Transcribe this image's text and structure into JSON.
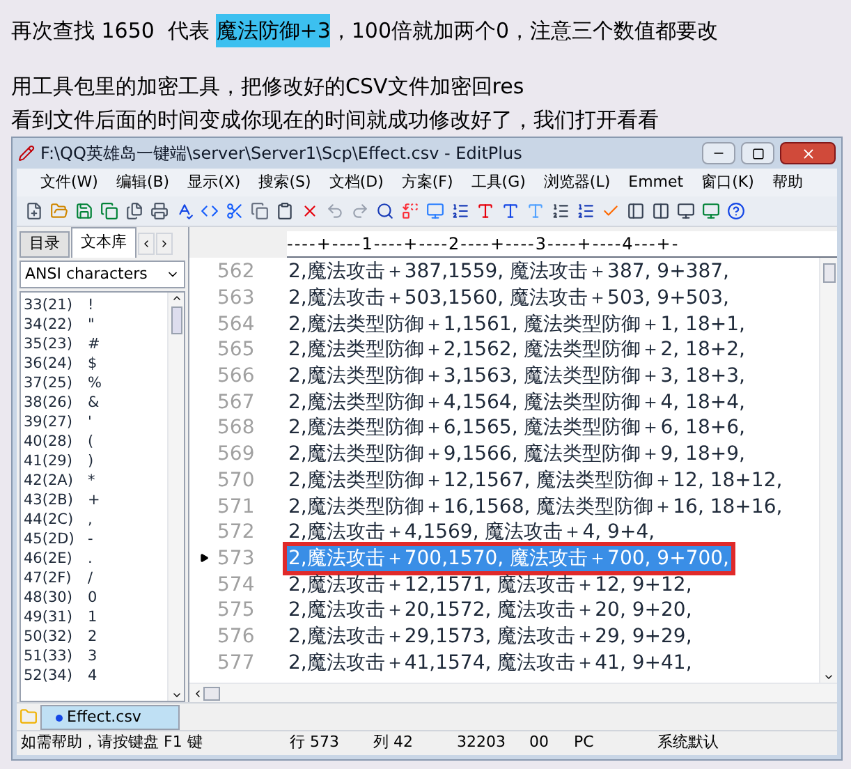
{
  "intro": [
    {
      "before": "再次查找 1650  代表 ",
      "highlight": "魔法防御+3",
      "after": "，100倍就加两个0，注意三个数值都要改"
    },
    {
      "before": "用工具包里的加密工具，把修改好的CSV文件加密回res"
    },
    {
      "before": "看到文件后面的时间变成你现在的时间就成功修改好了，我们打开看看"
    }
  ],
  "window": {
    "title": "F:\\QQ英雄岛一键端\\server\\Server1\\Scp\\Effect.csv - EditPlus"
  },
  "menu": [
    "文件(W)",
    "编辑(B)",
    "显示(X)",
    "搜索(S)",
    "文档(D)",
    "方案(F)",
    "工具(G)",
    "浏览器(L)",
    "Emmet",
    "窗口(K)",
    "帮助"
  ],
  "sidebar": {
    "tabs": [
      {
        "label": "目录",
        "selected": false
      },
      {
        "label": "文本库",
        "selected": true
      }
    ],
    "dropdown": "ANSI characters",
    "items": [
      {
        "code": "33(21)",
        "char": "!"
      },
      {
        "code": "34(22)",
        "char": "\""
      },
      {
        "code": "35(23)",
        "char": "#"
      },
      {
        "code": "36(24)",
        "char": "$"
      },
      {
        "code": "37(25)",
        "char": "%"
      },
      {
        "code": "38(26)",
        "char": "&"
      },
      {
        "code": "39(27)",
        "char": "'"
      },
      {
        "code": "40(28)",
        "char": "("
      },
      {
        "code": "41(29)",
        "char": ")"
      },
      {
        "code": "42(2A)",
        "char": "*"
      },
      {
        "code": "43(2B)",
        "char": "+"
      },
      {
        "code": "44(2C)",
        "char": ","
      },
      {
        "code": "45(2D)",
        "char": "-"
      },
      {
        "code": "46(2E)",
        "char": "."
      },
      {
        "code": "47(2F)",
        "char": "/"
      },
      {
        "code": "48(30)",
        "char": "0"
      },
      {
        "code": "49(31)",
        "char": "1"
      },
      {
        "code": "50(32)",
        "char": "2"
      },
      {
        "code": "51(33)",
        "char": "3"
      },
      {
        "code": "52(34)",
        "char": "4"
      }
    ]
  },
  "editor": {
    "ruler": "----+----1----+----2----+----3----+----4---+-",
    "lines": [
      {
        "number": "562",
        "text": "2,魔法攻击＋387,1559, 魔法攻击＋387, 9+387,",
        "selected": false
      },
      {
        "number": "563",
        "text": "2,魔法攻击＋503,1560, 魔法攻击＋503, 9+503,",
        "selected": false
      },
      {
        "number": "564",
        "text": "2,魔法类型防御＋1,1561, 魔法类型防御＋1, 18+1,",
        "selected": false
      },
      {
        "number": "565",
        "text": "2,魔法类型防御＋2,1562, 魔法类型防御＋2, 18+2,",
        "selected": false
      },
      {
        "number": "566",
        "text": "2,魔法类型防御＋3,1563, 魔法类型防御＋3, 18+3,",
        "selected": false
      },
      {
        "number": "567",
        "text": "2,魔法类型防御＋4,1564, 魔法类型防御＋4, 18+4,",
        "selected": false
      },
      {
        "number": "568",
        "text": "2,魔法类型防御＋6,1565, 魔法类型防御＋6, 18+6,",
        "selected": false
      },
      {
        "number": "569",
        "text": "2,魔法类型防御＋9,1566, 魔法类型防御＋9, 18+9,",
        "selected": false
      },
      {
        "number": "570",
        "text": "2,魔法类型防御＋12,1567, 魔法类型防御＋12, 18+12,",
        "selected": false
      },
      {
        "number": "571",
        "text": "2,魔法类型防御＋16,1568, 魔法类型防御＋16, 18+16,",
        "selected": false
      },
      {
        "number": "572",
        "text": "2,魔法攻击＋4,1569, 魔法攻击＋4, 9+4,",
        "selected": false
      },
      {
        "number": "573",
        "text": "2,魔法攻击＋700,1570, 魔法攻击＋700, 9+700,",
        "selected": true
      },
      {
        "number": "574",
        "text": "2,魔法攻击＋12,1571, 魔法攻击＋12, 9+12,",
        "selected": false
      },
      {
        "number": "575",
        "text": "2,魔法攻击＋20,1572, 魔法攻击＋20, 9+20,",
        "selected": false
      },
      {
        "number": "576",
        "text": "2,魔法攻击＋29,1573, 魔法攻击＋29, 9+29,",
        "selected": false
      },
      {
        "number": "577",
        "text": "2,魔法攻击＋41,1574, 魔法攻击＋41, 9+41,",
        "selected": false
      }
    ]
  },
  "document_tab": "Effect.csv",
  "status_bar": [
    "如需帮助，请按键盘 F1 键",
    "行 573",
    "列 42",
    "32203",
    "00",
    "PC",
    "系统默认"
  ]
}
